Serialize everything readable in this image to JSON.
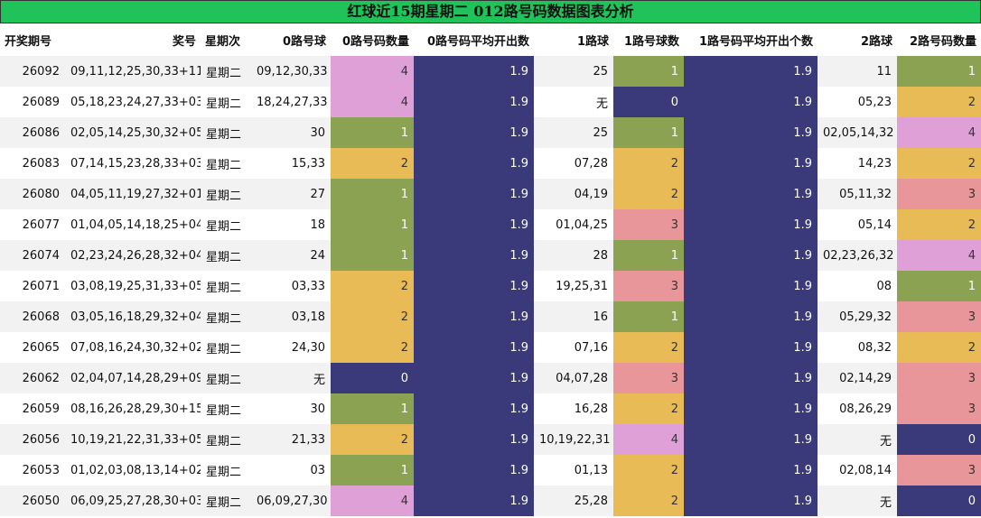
{
  "title": "红球近15期星期二 012路号码数据图表分析",
  "headers": [
    "开奖期号",
    "奖号",
    "星期次",
    "0路号球",
    "0路号码数量",
    "0路号码平均开出数",
    "1路球",
    "1路号球数",
    "1路号码平均开出个数",
    "2路球",
    "2路号码数量"
  ],
  "colors": {
    "title_bg": "#1fc35a",
    "avg_bg": "#3a3a7a",
    "count_0": "#3a3a7a",
    "count_1": "#8ba253",
    "count_2": "#e8bb56",
    "count_3": "#e8969a",
    "count_4": "#dfa0d8"
  },
  "rows": [
    [
      "26092",
      "09,11,12,25,30,33+11",
      "星期二",
      "09,12,30,33",
      "4",
      "1.9",
      "25",
      "1",
      "1.9",
      "11",
      "1"
    ],
    [
      "26089",
      "05,18,23,24,27,33+03",
      "星期二",
      "18,24,27,33",
      "4",
      "1.9",
      "无",
      "0",
      "1.9",
      "05,23",
      "2"
    ],
    [
      "26086",
      "02,05,14,25,30,32+05",
      "星期二",
      "30",
      "1",
      "1.9",
      "25",
      "1",
      "1.9",
      "02,05,14,32",
      "4"
    ],
    [
      "26083",
      "07,14,15,23,28,33+03",
      "星期二",
      "15,33",
      "2",
      "1.9",
      "07,28",
      "2",
      "1.9",
      "14,23",
      "2"
    ],
    [
      "26080",
      "04,05,11,19,27,32+01",
      "星期二",
      "27",
      "1",
      "1.9",
      "04,19",
      "2",
      "1.9",
      "05,11,32",
      "3"
    ],
    [
      "26077",
      "01,04,05,14,18,25+04",
      "星期二",
      "18",
      "1",
      "1.9",
      "01,04,25",
      "3",
      "1.9",
      "05,14",
      "2"
    ],
    [
      "26074",
      "02,23,24,26,28,32+04",
      "星期二",
      "24",
      "1",
      "1.9",
      "28",
      "1",
      "1.9",
      "02,23,26,32",
      "4"
    ],
    [
      "26071",
      "03,08,19,25,31,33+05",
      "星期二",
      "03,33",
      "2",
      "1.9",
      "19,25,31",
      "3",
      "1.9",
      "08",
      "1"
    ],
    [
      "26068",
      "03,05,16,18,29,32+04",
      "星期二",
      "03,18",
      "2",
      "1.9",
      "16",
      "1",
      "1.9",
      "05,29,32",
      "3"
    ],
    [
      "26065",
      "07,08,16,24,30,32+02",
      "星期二",
      "24,30",
      "2",
      "1.9",
      "07,16",
      "2",
      "1.9",
      "08,32",
      "2"
    ],
    [
      "26062",
      "02,04,07,14,28,29+09",
      "星期二",
      "无",
      "0",
      "1.9",
      "04,07,28",
      "3",
      "1.9",
      "02,14,29",
      "3"
    ],
    [
      "26059",
      "08,16,26,28,29,30+15",
      "星期二",
      "30",
      "1",
      "1.9",
      "16,28",
      "2",
      "1.9",
      "08,26,29",
      "3"
    ],
    [
      "26056",
      "10,19,21,22,31,33+05",
      "星期二",
      "21,33",
      "2",
      "1.9",
      "10,19,22,31",
      "4",
      "1.9",
      "无",
      "0"
    ],
    [
      "26053",
      "01,02,03,08,13,14+02",
      "星期二",
      "03",
      "1",
      "1.9",
      "01,13",
      "2",
      "1.9",
      "02,08,14",
      "3"
    ],
    [
      "26050",
      "06,09,25,27,28,30+03",
      "星期二",
      "06,09,27,30",
      "4",
      "1.9",
      "25,28",
      "2",
      "1.9",
      "无",
      "0"
    ]
  ]
}
